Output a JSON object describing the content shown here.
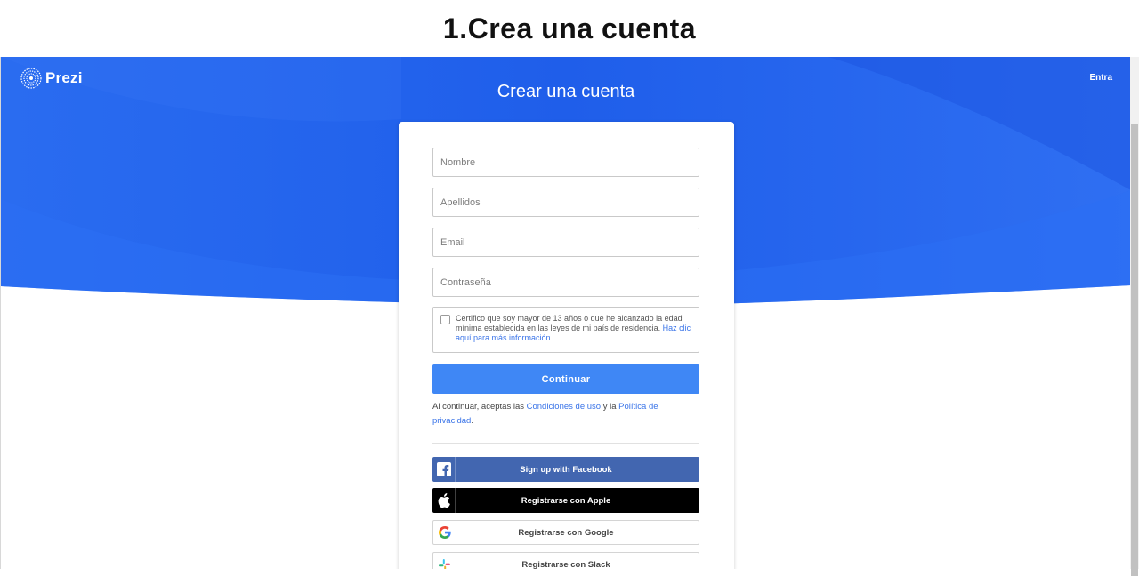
{
  "caption": "1.Crea una cuenta",
  "header": {
    "logo_text": "Prezi",
    "login_link": "Entra"
  },
  "page_title": "Crear una cuenta",
  "form": {
    "first_name_placeholder": "Nombre",
    "last_name_placeholder": "Apellidos",
    "email_placeholder": "Email",
    "password_placeholder": "Contraseña",
    "consent_text": "Certifico que soy mayor de 13 años o que he alcanzado la edad mínima establecida en las leyes de mi país de residencia.",
    "consent_link": "Haz clic aquí para más información.",
    "continue_label": "Continuar",
    "terms_prefix": "Al continuar, aceptas las",
    "terms_link": "Condiciones de uso",
    "terms_mid": "y la",
    "privacy_link": "Política de privacidad",
    "terms_suffix": "."
  },
  "social": {
    "facebook_label": "Sign up with Facebook",
    "apple_label": "Registrarse con Apple",
    "google_label": "Registrarse con Google",
    "slack_label": "Registrarse con Slack"
  },
  "colors": {
    "hero_blue": "#2461ec",
    "button_blue": "#3f87f5",
    "link_blue": "#3a74e8",
    "facebook": "#4266b0",
    "apple": "#000000"
  }
}
